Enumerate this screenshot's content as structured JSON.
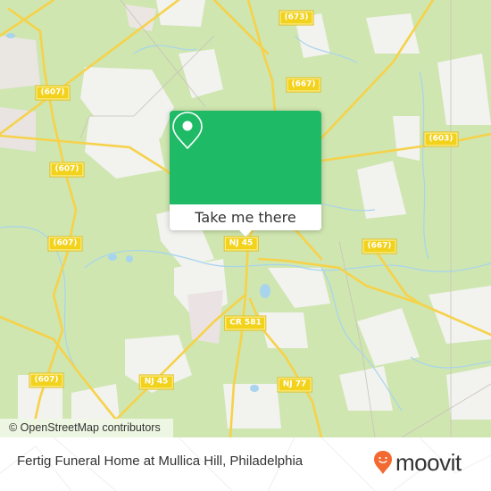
{
  "map": {
    "colors": {
      "forest": "#cfe6b0",
      "open_land": "#f2f2ef",
      "road_primary": "#f6d24a",
      "water": "#a8d4ee"
    },
    "road_labels": [
      {
        "id": "cr607-a",
        "text": "(607)"
      },
      {
        "id": "cr607-b",
        "text": "(607)"
      },
      {
        "id": "cr607-c",
        "text": "(607)"
      },
      {
        "id": "cr607-d",
        "text": "(607)"
      },
      {
        "id": "cr607-e",
        "text": "(607)"
      },
      {
        "id": "cr673",
        "text": "(673)"
      },
      {
        "id": "cr667-a",
        "text": "(667)"
      },
      {
        "id": "cr667-b",
        "text": "(667)"
      },
      {
        "id": "cr603",
        "text": "(603)"
      },
      {
        "id": "nj45-a",
        "text": "NJ 45"
      },
      {
        "id": "nj45-b",
        "text": "NJ 45"
      },
      {
        "id": "cr581",
        "text": "CR 581"
      },
      {
        "id": "nj77",
        "text": "NJ 77"
      }
    ],
    "attribution": "© OpenStreetMap contributors"
  },
  "popup": {
    "icon": "location-pin-icon",
    "button_label": "Take me there",
    "accent_color": "#1fba66"
  },
  "footer": {
    "place_name": "Fertig Funeral Home at Mullica Hill, Philadelphia",
    "brand_name": "moovit",
    "brand_color": "#f26a31"
  }
}
